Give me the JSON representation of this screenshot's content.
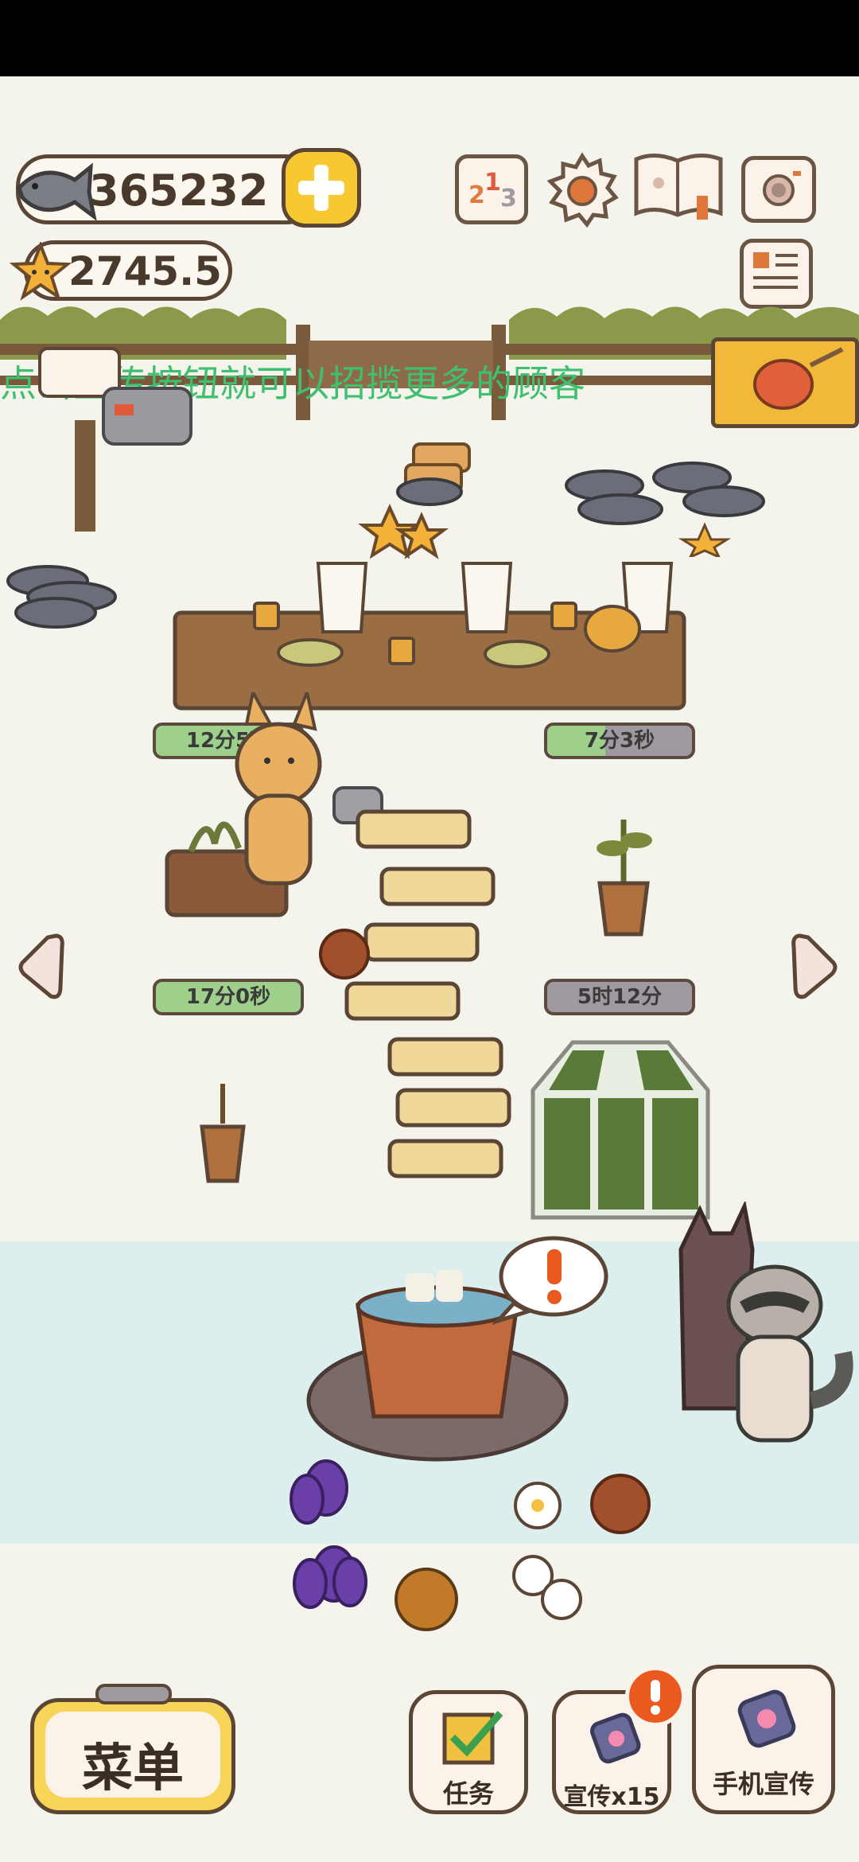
{
  "currency": {
    "fish_amount": "365232",
    "star_amount": "2745.5"
  },
  "banner": {
    "message": "点击宣传按钮就可以招揽更多的顾客"
  },
  "timers": {
    "plot_top_left": "12分5秒",
    "plot_top_right": "7分3秒",
    "plot_mid_left": "17分0秒",
    "plot_mid_right": "5时12分"
  },
  "bottom": {
    "menu_label": "菜单",
    "tasks_label": "任务",
    "promote_label": "宣传x15",
    "phone_promote_label": "手机宣传"
  },
  "icons": {
    "top": [
      "ranking-icon",
      "settings-gear-icon",
      "recipe-book-icon",
      "camera-icon",
      "newspaper-icon"
    ],
    "notification": "exclamation-icon"
  },
  "colors": {
    "accent_yellow": "#f8c830",
    "outline_brown": "#5b4636",
    "timer_green": "#9ed08c",
    "timer_gray": "#a09aa0",
    "banner_text": "#3fbf70",
    "alert_orange": "#e85a20"
  }
}
